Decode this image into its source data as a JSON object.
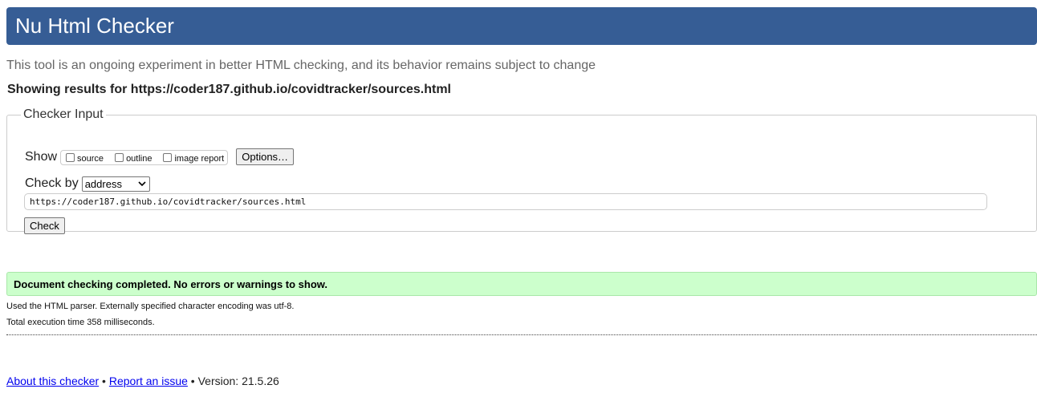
{
  "header": {
    "title": "Nu Html Checker",
    "background_color": "#365d95"
  },
  "intro": "This tool is an ongoing experiment in better HTML checking, and its behavior remains subject to change",
  "showing_results": "Showing results for https://coder187.github.io/covidtracker/sources.html",
  "checker_input": {
    "legend": "Checker Input",
    "show_label": "Show",
    "show_options": [
      {
        "label": "source",
        "checked": false
      },
      {
        "label": "outline",
        "checked": false
      },
      {
        "label": "image report",
        "checked": false
      }
    ],
    "options_button": "Options…",
    "check_by_label": "Check by",
    "check_by_value": "address",
    "url_value": "https://coder187.github.io/covidtracker/sources.html",
    "check_button": "Check"
  },
  "result": {
    "message": "Document checking completed. No errors or warnings to show.",
    "background_color": "#ccffcc",
    "details": [
      "Used the HTML parser. Externally specified character encoding was utf-8.",
      "Total execution time 358 milliseconds."
    ]
  },
  "footer": {
    "about_link": "About this checker",
    "separator1": " • ",
    "report_link": "Report an issue",
    "version_text": " • Version: 21.5.26"
  }
}
